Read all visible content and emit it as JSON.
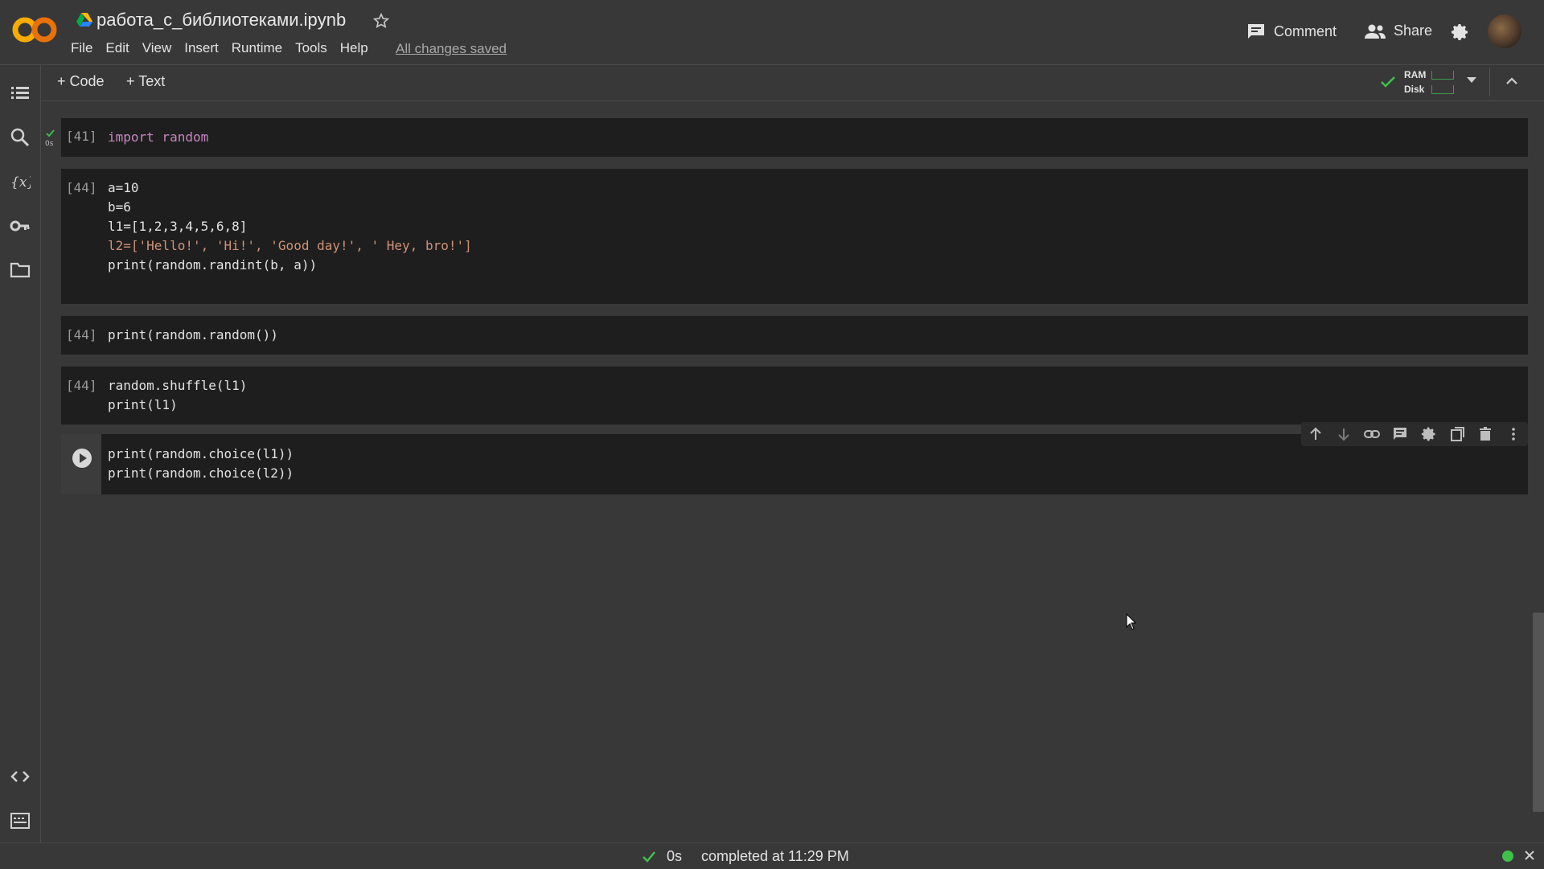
{
  "header": {
    "title": "работа_с_библиотеками.ipynb",
    "menu": [
      "File",
      "Edit",
      "View",
      "Insert",
      "Runtime",
      "Tools",
      "Help"
    ],
    "save_status": "All changes saved",
    "comment_label": "Comment",
    "share_label": "Share"
  },
  "toolbar": {
    "add_code": "+ Code",
    "add_text": "+ Text",
    "ram_label": "RAM",
    "disk_label": "Disk"
  },
  "exec_time_badge": "0s",
  "cells": [
    {
      "count": "[41]",
      "lines": [
        "import random"
      ]
    },
    {
      "count": "[44]",
      "lines": [
        "a=10",
        "b=6",
        "l1=[1,2,3,4,5,6,8]",
        "l2=['Hello!', 'Hi!', 'Good day!', ' Hey, bro!']",
        "",
        "print(random.randint(b, a))"
      ]
    },
    {
      "count": "[44]",
      "lines": [
        "print(random.random())"
      ]
    },
    {
      "count": "[44]",
      "lines": [
        "random.shuffle(l1)",
        "print(l1)"
      ]
    },
    {
      "count": "",
      "lines": [
        "print(random.choice(l1))",
        "print(random.choice(l2))"
      ]
    }
  ],
  "statusbar": {
    "time": "0s",
    "text": "completed at 11:29 PM"
  },
  "colors": {
    "background": "#383838",
    "cell_background": "#1e1e1e",
    "keyword": "#c586c0",
    "string": "#ce9178",
    "bracket": "#e8c900",
    "status_ok": "#3ec24a"
  }
}
